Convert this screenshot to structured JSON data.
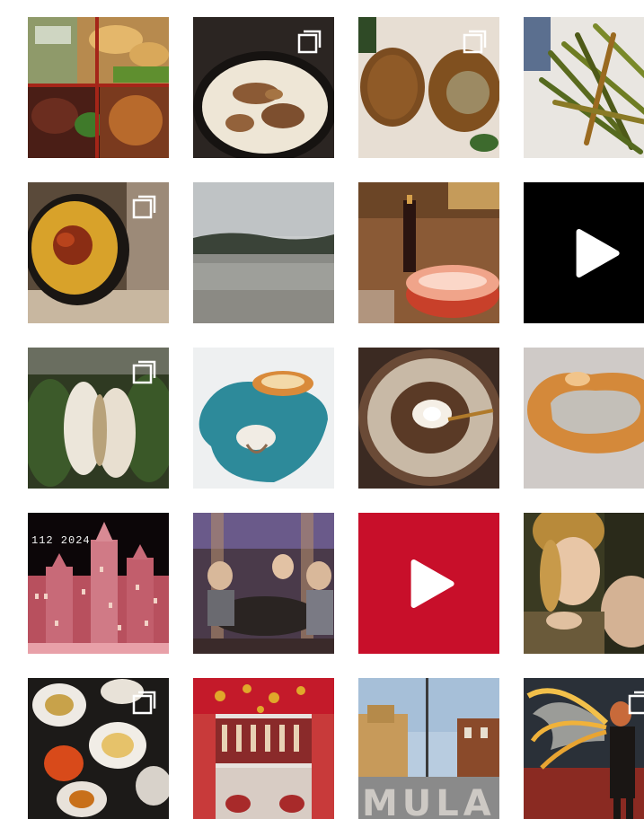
{
  "grid": {
    "tiles": [
      {
        "id": "bento-box",
        "type": "image"
      },
      {
        "id": "mushroom-soup",
        "type": "carousel"
      },
      {
        "id": "croquettes",
        "type": "carousel"
      },
      {
        "id": "green-beans",
        "type": "image"
      },
      {
        "id": "paella-pan",
        "type": "carousel"
      },
      {
        "id": "snowy-field",
        "type": "image"
      },
      {
        "id": "birthday-cake",
        "type": "image"
      },
      {
        "id": "black-video",
        "type": "video"
      },
      {
        "id": "bao-buns",
        "type": "carousel"
      },
      {
        "id": "blue-plate-dessert",
        "type": "image"
      },
      {
        "id": "roscon-cake",
        "type": "image"
      },
      {
        "id": "sugar-pastry",
        "type": "image"
      },
      {
        "id": "lit-palace",
        "type": "image",
        "overlay_text": "112 2024"
      },
      {
        "id": "restaurant-group",
        "type": "image"
      },
      {
        "id": "red-video",
        "type": "video"
      },
      {
        "id": "renaissance-painting",
        "type": "image"
      },
      {
        "id": "tapas-table",
        "type": "carousel"
      },
      {
        "id": "bar-interior",
        "type": "image"
      },
      {
        "id": "mula-town",
        "type": "image",
        "overlay_text": "MULA"
      },
      {
        "id": "angel-mural",
        "type": "carousel"
      }
    ]
  },
  "icons": {
    "carousel": "carousel-icon",
    "play": "play-icon"
  },
  "colors": {
    "video_black": "#000000",
    "video_red": "#c80f2a",
    "icon_white": "#ffffff"
  }
}
